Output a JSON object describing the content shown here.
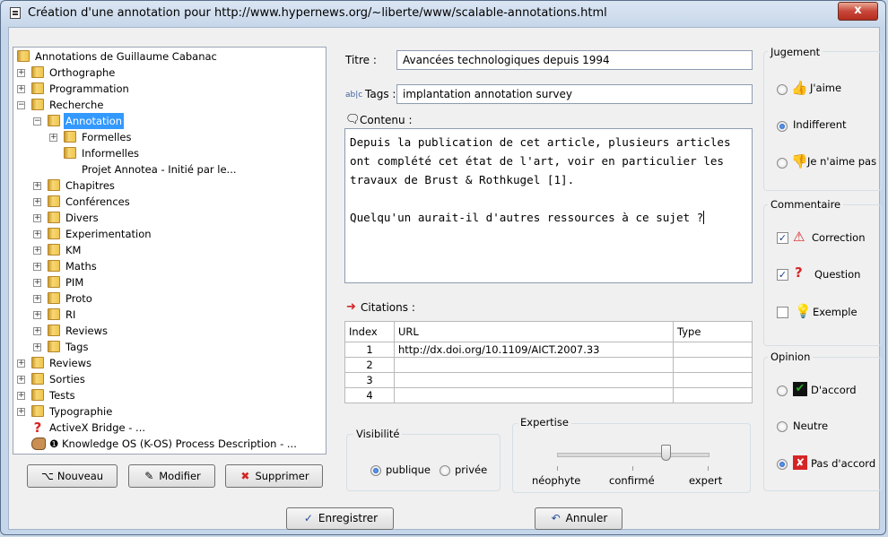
{
  "window": {
    "title": "Création d'une annotation pour http://www.hypernews.org/~liberte/www/scalable-annotations.html",
    "close_glyph": "x"
  },
  "tree": {
    "items": [
      {
        "label": "Annotations de Guillaume Cabanac",
        "type": "folder"
      },
      {
        "label": "Orthographe",
        "type": "folder"
      },
      {
        "label": "Programmation",
        "type": "folder"
      },
      {
        "label": "Recherche",
        "type": "folder"
      },
      {
        "label": "Annotation",
        "type": "folder",
        "selected": true
      },
      {
        "label": "Formelles",
        "type": "folder"
      },
      {
        "label": "Informelles",
        "type": "folder"
      },
      {
        "label": "Projet Annotea - Initié par le...",
        "type": "text"
      },
      {
        "label": "Chapitres",
        "type": "folder"
      },
      {
        "label": "Conférences",
        "type": "folder"
      },
      {
        "label": "Divers",
        "type": "folder"
      },
      {
        "label": "Experimentation",
        "type": "folder"
      },
      {
        "label": "KM",
        "type": "folder"
      },
      {
        "label": "Maths",
        "type": "folder"
      },
      {
        "label": "PIM",
        "type": "folder"
      },
      {
        "label": "Proto",
        "type": "folder"
      },
      {
        "label": "RI",
        "type": "folder"
      },
      {
        "label": "Reviews",
        "type": "folder"
      },
      {
        "label": "Tags",
        "type": "folder"
      },
      {
        "label": "Reviews",
        "type": "folder"
      },
      {
        "label": "Sorties",
        "type": "folder"
      },
      {
        "label": "Tests",
        "type": "folder"
      },
      {
        "label": "Typographie",
        "type": "folder"
      },
      {
        "label": "ActiveX Bridge - ...",
        "type": "question"
      },
      {
        "label": "Knowledge OS (K-OS) Process Description - ...",
        "type": "hand"
      }
    ],
    "info_glyph": "❶"
  },
  "left_buttons": {
    "new": "Nouveau",
    "edit": "Modifier",
    "delete": "Supprimer"
  },
  "form": {
    "title_label": "Titre :",
    "title_value": "Avancées technologiques depuis 1994",
    "tags_label": "Tags :",
    "tags_value": "implantation annotation survey",
    "tags_icon_text": "ab|c",
    "content_label": "Contenu :",
    "content_value": "Depuis la publication de cet article, plusieurs articles ont complété cet état de l'art, voir en particulier les travaux de Brust & Rothkugel [1].\n\nQuelqu'un aurait-il d'autres ressources à ce sujet ?",
    "citations_label": "Citations :"
  },
  "citations": {
    "headers": [
      "Index",
      "URL",
      "Type"
    ],
    "rows": [
      {
        "index": "1",
        "url": "http://dx.doi.org/10.1109/AICT.2007.33",
        "type": ""
      },
      {
        "index": "2",
        "url": "",
        "type": ""
      },
      {
        "index": "3",
        "url": "",
        "type": ""
      },
      {
        "index": "4",
        "url": "",
        "type": ""
      }
    ]
  },
  "visibility": {
    "title": "Visibilité",
    "options": [
      "publique",
      "privée"
    ],
    "selected": "publique"
  },
  "expertise": {
    "title": "Expertise",
    "levels": [
      "néophyte",
      "confirmé",
      "expert"
    ],
    "value_fraction": 0.72
  },
  "jugement": {
    "title": "Jugement",
    "options": [
      "J'aime",
      "Indifferent",
      "Je n'aime pas"
    ],
    "selected": "Indifferent"
  },
  "commentaire": {
    "title": "Commentaire",
    "options": [
      {
        "label": "Correction",
        "checked": true
      },
      {
        "label": "Question",
        "checked": true
      },
      {
        "label": "Exemple",
        "checked": false
      }
    ]
  },
  "opinion": {
    "title": "Opinion",
    "options": [
      "D'accord",
      "Neutre",
      "Pas d'accord"
    ],
    "selected": "Pas d'accord"
  },
  "bottom_buttons": {
    "save": "Enregistrer",
    "cancel": "Annuler"
  },
  "colors": {
    "selection": "#3399ff",
    "check_green": "#2aa12a",
    "cross_red": "#d62424"
  }
}
